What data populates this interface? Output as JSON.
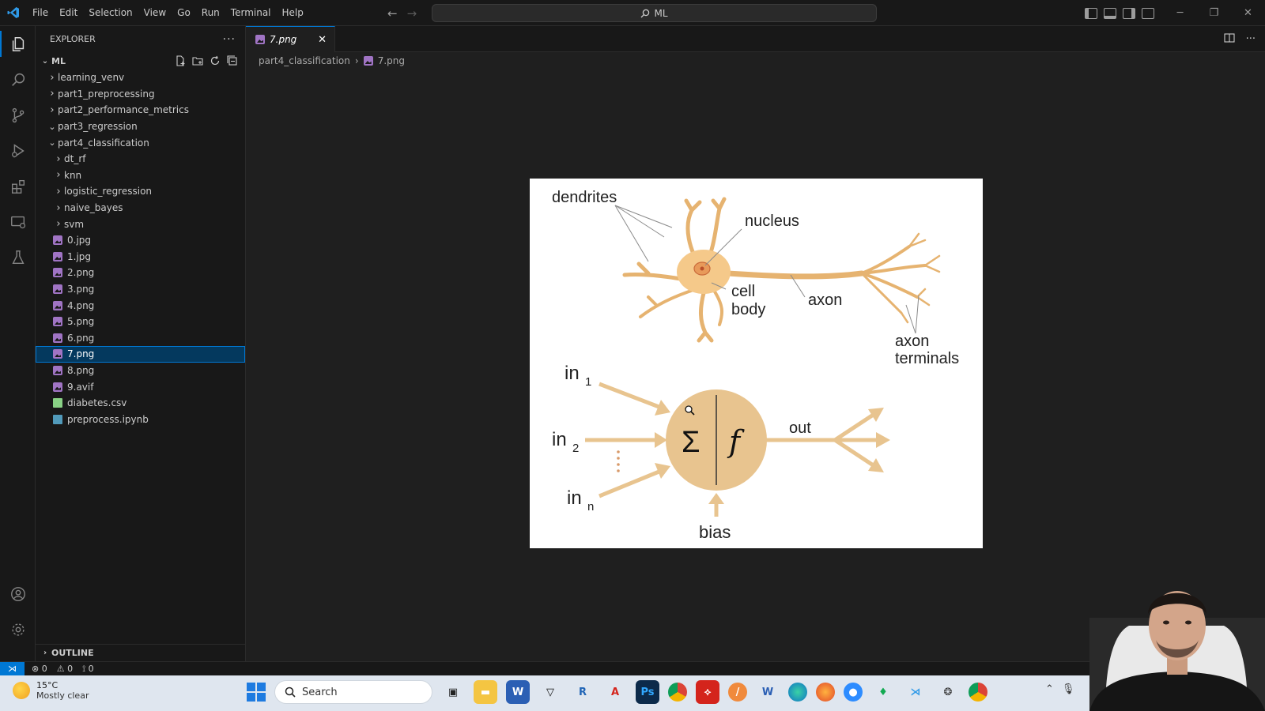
{
  "menu": [
    "File",
    "Edit",
    "Selection",
    "View",
    "Go",
    "Run",
    "Terminal",
    "Help"
  ],
  "command_center": {
    "label": "ML"
  },
  "explorer": {
    "title": "EXPLORER",
    "workspace": "ML",
    "items": [
      {
        "label": "learning_venv",
        "kind": "folder",
        "expanded": false,
        "depth": 1
      },
      {
        "label": "part1_preprocessing",
        "kind": "folder",
        "expanded": false,
        "depth": 1
      },
      {
        "label": "part2_performance_metrics",
        "kind": "folder",
        "expanded": false,
        "depth": 1
      },
      {
        "label": "part3_regression",
        "kind": "folder",
        "expanded": true,
        "depth": 1
      },
      {
        "label": "part4_classification",
        "kind": "folder",
        "expanded": true,
        "depth": 1
      },
      {
        "label": "dt_rf",
        "kind": "folder",
        "expanded": false,
        "depth": 2
      },
      {
        "label": "knn",
        "kind": "folder",
        "expanded": false,
        "depth": 2
      },
      {
        "label": "logistic_regression",
        "kind": "folder",
        "expanded": false,
        "depth": 2
      },
      {
        "label": "naive_bayes",
        "kind": "folder",
        "expanded": false,
        "depth": 2
      },
      {
        "label": "svm",
        "kind": "folder",
        "expanded": false,
        "depth": 2
      },
      {
        "label": "0.jpg",
        "kind": "image",
        "depth": 2
      },
      {
        "label": "1.jpg",
        "kind": "image",
        "depth": 2
      },
      {
        "label": "2.png",
        "kind": "image",
        "depth": 2
      },
      {
        "label": "3.png",
        "kind": "image",
        "depth": 2
      },
      {
        "label": "4.png",
        "kind": "image",
        "depth": 2
      },
      {
        "label": "5.png",
        "kind": "image",
        "depth": 2
      },
      {
        "label": "6.png",
        "kind": "image",
        "depth": 2
      },
      {
        "label": "7.png",
        "kind": "image",
        "depth": 2,
        "selected": true
      },
      {
        "label": "8.png",
        "kind": "image",
        "depth": 2
      },
      {
        "label": "9.avif",
        "kind": "image",
        "depth": 2
      },
      {
        "label": "diabetes.csv",
        "kind": "csv",
        "depth": 2
      },
      {
        "label": "preprocess.ipynb",
        "kind": "notebook",
        "depth": 2
      }
    ],
    "outline": "OUTLINE"
  },
  "tab": {
    "label": "7.png",
    "close": "✕"
  },
  "breadcrumb": {
    "folder": "part4_classification",
    "file": "7.png"
  },
  "figure": {
    "dendrites": "dendrites",
    "nucleus": "nucleus",
    "cell": "cell",
    "body": "body",
    "axon": "axon",
    "axon_t1": "axon",
    "axon_t2": "terminals",
    "in_base": "in",
    "in1_sub": "1",
    "in2_sub": "2",
    "inn_sub": "n",
    "sigma": "Σ",
    "f": "f",
    "out": "out",
    "bias": "bias"
  },
  "status": {
    "errors": "0",
    "warnings": "0",
    "ports": "0"
  },
  "taskbar": {
    "temp": "15°C",
    "weather": "Mostly clear",
    "search": "Search"
  },
  "colors": {
    "accent": "#0078d4",
    "neuron": "#f5c98a",
    "neuron_dark": "#d9a05c",
    "node": "#e8c48f"
  }
}
